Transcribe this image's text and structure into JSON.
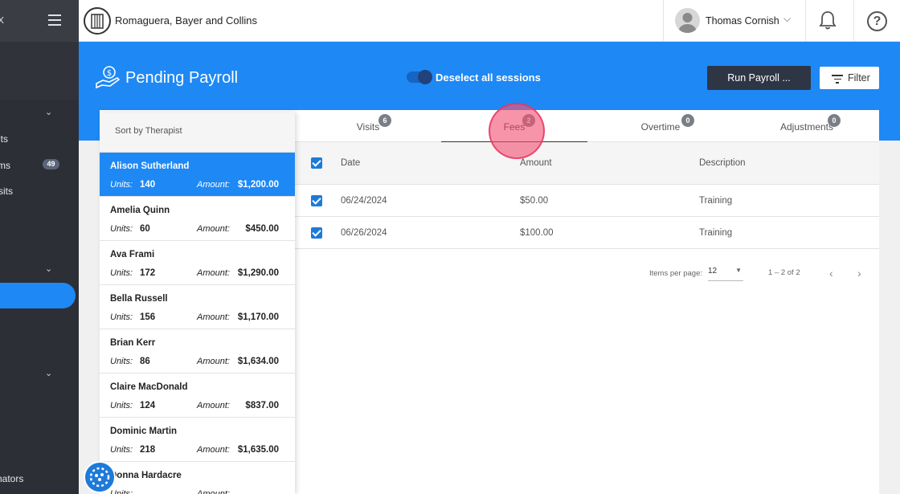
{
  "sidebar": {
    "brand_fragment": "ix",
    "items": [
      {
        "label": "its"
      },
      {
        "label": "ms",
        "badge": "49"
      },
      {
        "label": "sits"
      },
      {
        "label": "nators"
      }
    ]
  },
  "header": {
    "org_name": "Romaguera, Bayer and Collins",
    "user_name": "Thomas Cornish"
  },
  "banner": {
    "title": "Pending Payroll",
    "toggle_label": "Deselect all sessions",
    "run_button": "Run Payroll ...",
    "filter_button": "Filter"
  },
  "tabs": [
    {
      "label": "Visits",
      "count": "6"
    },
    {
      "label": "Fees",
      "count": "2",
      "active": true
    },
    {
      "label": "Overtime",
      "count": "0"
    },
    {
      "label": "Adjustments",
      "count": "0"
    }
  ],
  "table": {
    "columns": [
      "Date",
      "Amount",
      "Description"
    ],
    "rows": [
      {
        "date": "06/24/2024",
        "amount": "$50.00",
        "description": "Training"
      },
      {
        "date": "06/26/2024",
        "amount": "$100.00",
        "description": "Training"
      }
    ]
  },
  "pager": {
    "items_label": "Items per page:",
    "page_size": "12",
    "range": "1 – 2 of 2"
  },
  "therapist_list": {
    "header": "Sort by Therapist",
    "units_label": "Units:",
    "amount_label": "Amount:",
    "items": [
      {
        "name": "Alison Sutherland",
        "units": "140",
        "amount": "$1,200.00"
      },
      {
        "name": "Amelia Quinn",
        "units": "60",
        "amount": "$450.00"
      },
      {
        "name": "Ava Frami",
        "units": "172",
        "amount": "$1,290.00"
      },
      {
        "name": "Bella Russell",
        "units": "156",
        "amount": "$1,170.00"
      },
      {
        "name": "Brian Kerr",
        "units": "86",
        "amount": "$1,634.00"
      },
      {
        "name": "Claire MacDonald",
        "units": "124",
        "amount": "$837.00"
      },
      {
        "name": "Dominic Martin",
        "units": "218",
        "amount": "$1,635.00"
      },
      {
        "name": "Donna Hardacre",
        "units": "",
        "amount": ""
      }
    ]
  },
  "colors": {
    "primary": "#1e88f5",
    "sidebar": "#2c2f36",
    "run_button": "#2e3646",
    "cursor_highlight": "#f45275"
  }
}
